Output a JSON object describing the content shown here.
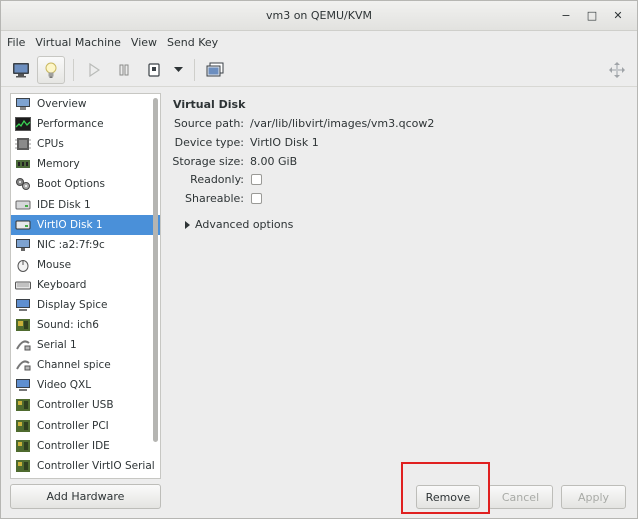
{
  "window": {
    "title": "vm3 on QEMU/KVM",
    "controls": [
      "−",
      "□",
      "✕"
    ]
  },
  "menu": [
    "File",
    "Virtual Machine",
    "View",
    "Send Key"
  ],
  "toolbar": {
    "buttons": [
      "console-icon",
      "details-bulb-icon",
      "run-icon",
      "pause-icon",
      "shutdown-icon",
      "dropdown-arrow-icon",
      "snapshots-icon"
    ],
    "right_icon": "fullscreen-move-icon"
  },
  "sidebar": {
    "items": [
      {
        "label": "Overview",
        "icon": "overview-icon"
      },
      {
        "label": "Performance",
        "icon": "performance-icon"
      },
      {
        "label": "CPUs",
        "icon": "cpu-icon"
      },
      {
        "label": "Memory",
        "icon": "memory-icon"
      },
      {
        "label": "Boot Options",
        "icon": "boot-options-icon"
      },
      {
        "label": "IDE Disk 1",
        "icon": "disk-icon"
      },
      {
        "label": "VirtIO Disk 1",
        "icon": "disk-icon"
      },
      {
        "label": "NIC :a2:7f:9c",
        "icon": "network-icon"
      },
      {
        "label": "Mouse",
        "icon": "mouse-icon"
      },
      {
        "label": "Keyboard",
        "icon": "keyboard-icon"
      },
      {
        "label": "Display Spice",
        "icon": "display-icon"
      },
      {
        "label": "Sound: ich6",
        "icon": "sound-icon"
      },
      {
        "label": "Serial 1",
        "icon": "serial-icon"
      },
      {
        "label": "Channel spice",
        "icon": "channel-icon"
      },
      {
        "label": "Video QXL",
        "icon": "video-icon"
      },
      {
        "label": "Controller USB",
        "icon": "controller-icon"
      },
      {
        "label": "Controller PCI",
        "icon": "controller-icon"
      },
      {
        "label": "Controller IDE",
        "icon": "controller-icon"
      },
      {
        "label": "Controller VirtIO Serial",
        "icon": "controller-icon"
      }
    ],
    "selected": "VirtIO Disk 1",
    "add_hardware_label": "Add Hardware"
  },
  "details": {
    "title": "Virtual Disk",
    "source_path_label": "Source path:",
    "source_path_value": "/var/lib/libvirt/images/vm3.qcow2",
    "device_type_label": "Device type:",
    "device_type_value": "VirtIO Disk 1",
    "storage_size_label": "Storage size:",
    "storage_size_value": "8.00 GiB",
    "readonly_label": "Readonly:",
    "shareable_label": "Shareable:",
    "advanced_label": "Advanced options"
  },
  "buttons": {
    "remove": "Remove",
    "cancel": "Cancel",
    "apply": "Apply"
  },
  "colors": {
    "selection": "#4a90d9",
    "highlight": "#e02020"
  }
}
